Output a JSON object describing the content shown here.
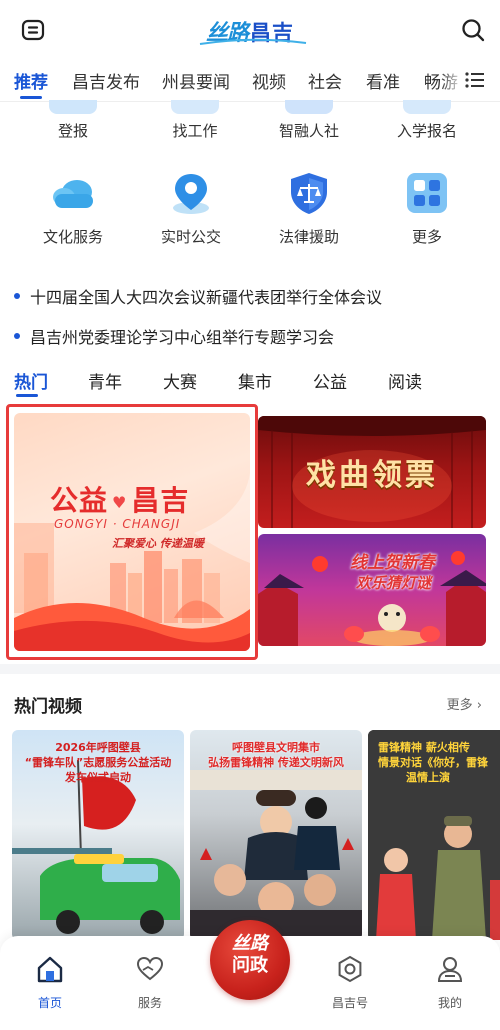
{
  "header": {
    "logo_script": "丝路",
    "logo_name": "昌吉"
  },
  "nav": {
    "tabs": [
      "推荐",
      "昌吉发布",
      "州县要闻",
      "视频",
      "社会",
      "看准",
      "畅游"
    ],
    "active": "推荐"
  },
  "services": {
    "row1": [
      "登报",
      "找工作",
      "智融人社",
      "入学报名"
    ],
    "row2": [
      "文化服务",
      "实时公交",
      "法律援助",
      "更多"
    ]
  },
  "news": [
    "十四届全国人大四次会议新疆代表团举行全体会议",
    "昌吉州党委理论学习中心组举行专题学习会"
  ],
  "section_tabs": {
    "tabs": [
      "热门",
      "青年",
      "大赛",
      "集市",
      "公益",
      "阅读"
    ],
    "active": "热门"
  },
  "banners": {
    "main": {
      "title_left": "公益",
      "title_right": "昌吉",
      "pinyin": "GONGYI · CHANGJI",
      "slogan": "汇聚爱心 传递温暖"
    },
    "opera": {
      "title": "戏曲领票"
    },
    "lantern": {
      "line1": "线上贺新春",
      "line2": "欢乐猜灯谜"
    }
  },
  "hot_videos": {
    "title": "热门视频",
    "more": "更多",
    "items": [
      {
        "caption_line1": "2026年呼图壁县",
        "caption_line2": "“雷锋车队”志愿服务公益活动",
        "caption_line3": "发车仪式启动"
      },
      {
        "caption_line1": "呼图壁县文明集市",
        "caption_line2": "弘扬雷锋精神 传递文明新风",
        "caption_line3": ""
      },
      {
        "caption_line1": "雷锋精神 薪火相传",
        "caption_line2": "情景对话《你好，雷锋",
        "caption_line3": "温情上演"
      }
    ]
  },
  "tabbar": {
    "items": [
      "首页",
      "服务",
      "昌吉号",
      "我的"
    ],
    "center_script": "丝路",
    "center_label": "问政",
    "active": "首页"
  },
  "colors": {
    "accent": "#1a56d6",
    "highlight_border": "#e73b3b",
    "center_button": "#c8221c"
  }
}
